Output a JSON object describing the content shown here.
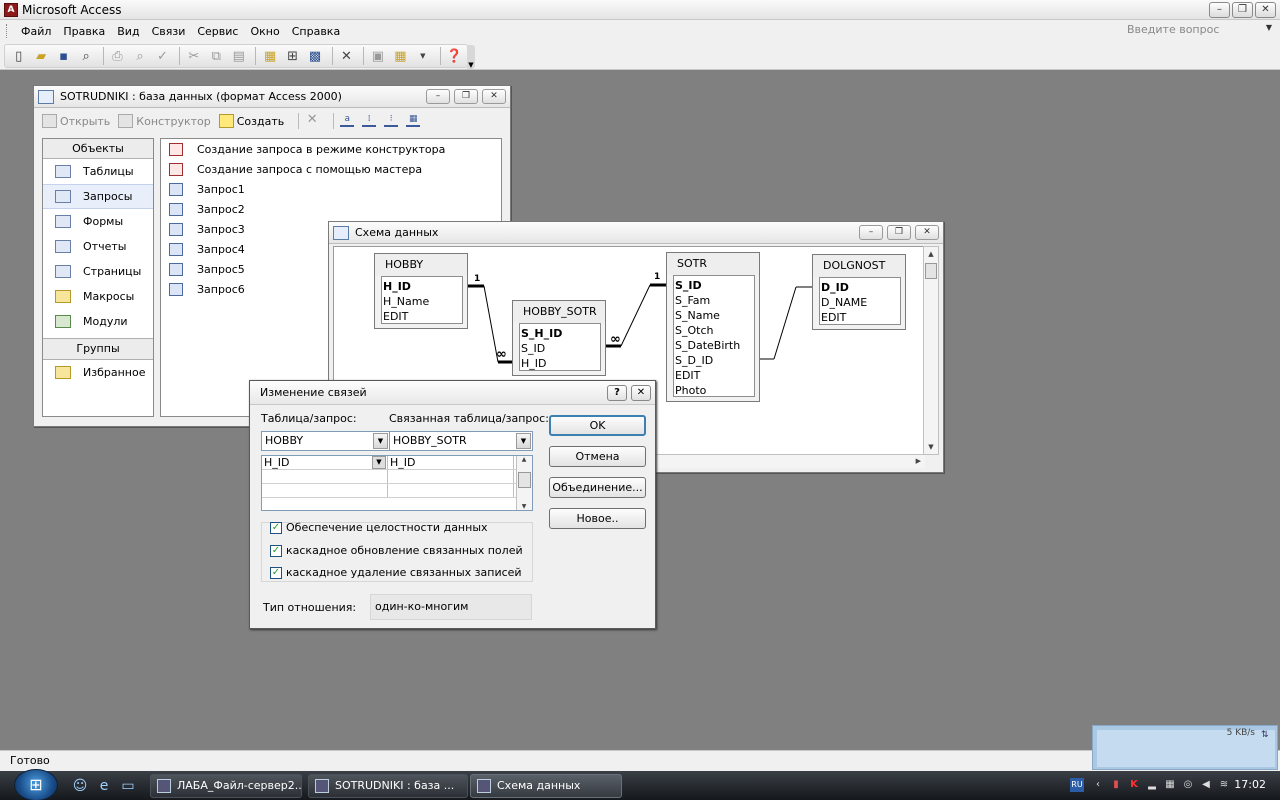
{
  "app": {
    "title": "Microsoft Access"
  },
  "menu": {
    "items": [
      "Файл",
      "Правка",
      "Вид",
      "Связи",
      "Сервис",
      "Окно",
      "Справка"
    ],
    "ask_placeholder": "Введите вопрос"
  },
  "db_window": {
    "title": "SOTRUDNIKI : база данных (формат Access 2000)",
    "toolbar": {
      "open": "Открыть",
      "design": "Конструктор",
      "create": "Создать"
    },
    "objects_header": "Объекты",
    "objects": [
      "Таблицы",
      "Запросы",
      "Формы",
      "Отчеты",
      "Страницы",
      "Макросы",
      "Модули"
    ],
    "selected_object": "Запросы",
    "groups_header": "Группы",
    "groups": [
      "Избранное"
    ],
    "list": [
      "Создание запроса в режиме конструктора",
      "Создание запроса с помощью мастера",
      "Запрос1",
      "Запрос2",
      "Запрос3",
      "Запрос4",
      "Запрос5",
      "Запрос6"
    ]
  },
  "schema_window": {
    "title": "Схема данных",
    "tables": [
      {
        "name": "HOBBY",
        "fields": [
          {
            "name": "H_ID",
            "pk": true
          },
          {
            "name": "H_Name",
            "pk": false
          },
          {
            "name": "EDIT",
            "pk": false
          }
        ]
      },
      {
        "name": "HOBBY_SOTR",
        "fields": [
          {
            "name": "S_H_ID",
            "pk": true
          },
          {
            "name": "S_ID",
            "pk": false
          },
          {
            "name": "H_ID",
            "pk": false
          }
        ]
      },
      {
        "name": "SOTR",
        "fields": [
          {
            "name": "S_ID",
            "pk": true
          },
          {
            "name": "S_Fam",
            "pk": false
          },
          {
            "name": "S_Name",
            "pk": false
          },
          {
            "name": "S_Otch",
            "pk": false
          },
          {
            "name": "S_DateBirth",
            "pk": false
          },
          {
            "name": "S_D_ID",
            "pk": false
          },
          {
            "name": "EDIT",
            "pk": false
          },
          {
            "name": "Photo",
            "pk": false
          }
        ]
      },
      {
        "name": "DOLGNOST",
        "fields": [
          {
            "name": "D_ID",
            "pk": true
          },
          {
            "name": "D_NAME",
            "pk": false
          },
          {
            "name": "EDIT",
            "pk": false
          }
        ]
      }
    ],
    "rel_labels": {
      "one": "1",
      "many": "∞"
    }
  },
  "dialog": {
    "title": "Изменение связей",
    "table_label": "Таблица/запрос:",
    "related_label": "Связанная таблица/запрос:",
    "table_value": "HOBBY",
    "related_value": "HOBBY_SOTR",
    "fields": [
      {
        "left": "H_ID",
        "right": "H_ID"
      }
    ],
    "buttons": {
      "ok": "OK",
      "cancel": "Отмена",
      "join": "Объединение...",
      "new": "Новое.."
    },
    "checkboxes": {
      "integrity": "Обеспечение целостности данных",
      "cascade_update": "каскадное обновление связанных полей",
      "cascade_delete": "каскадное удаление связанных записей"
    },
    "checked": {
      "integrity": true,
      "cascade_update": true,
      "cascade_delete": true
    },
    "reltype_label": "Тип отношения:",
    "reltype_value": "один-ко-многим"
  },
  "status": {
    "text": "Готово"
  },
  "netmon": {
    "rate": "5 KB/s"
  },
  "taskbar": {
    "tasks": [
      "ЛАБА_Файл-сервер2....",
      "SOTRUDNIKI : база ...",
      "Схема данных"
    ],
    "lang": "RU",
    "clock": "17:02"
  }
}
